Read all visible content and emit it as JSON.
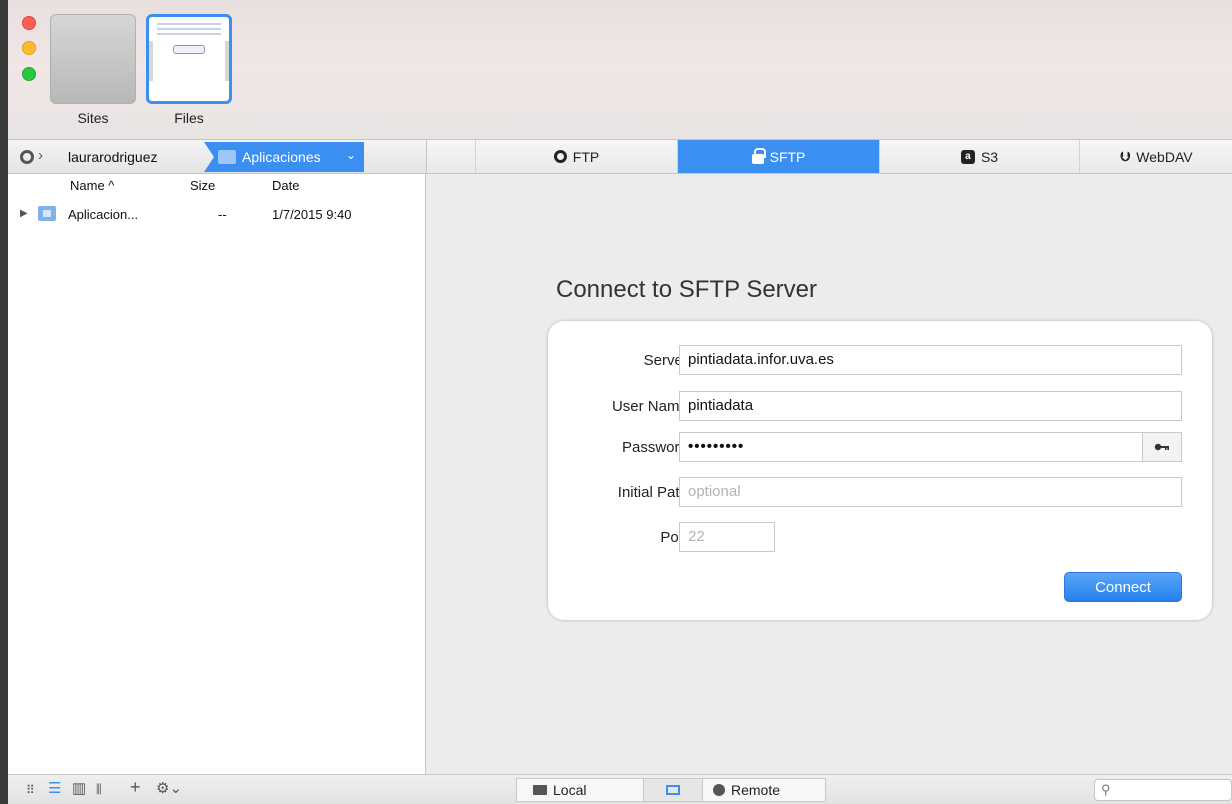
{
  "window": {
    "traffic_lights": [
      "close",
      "minimize",
      "zoom"
    ],
    "colors": {
      "accent": "#3b8ff1",
      "close": "#fc5f57",
      "minimize": "#fdbc2e",
      "zoom": "#29c840"
    }
  },
  "toolbar": {
    "modes": [
      {
        "label": "Sites",
        "selected": false
      },
      {
        "label": "Files",
        "selected": true
      }
    ]
  },
  "breadcrumb": {
    "user": "laurarodriguez",
    "current_folder": "Aplicaciones"
  },
  "protocol_tabs": [
    {
      "label": "FTP",
      "icon": "ftp-ring-icon",
      "active": false
    },
    {
      "label": "SFTP",
      "icon": "lock-icon",
      "active": true
    },
    {
      "label": "S3",
      "icon": "s3-icon",
      "active": false
    },
    {
      "label": "WebDAV",
      "icon": "webdav-icon",
      "active": false
    }
  ],
  "filelist": {
    "columns": {
      "name": "Name ^",
      "size": "Size",
      "date": "Date"
    },
    "rows": [
      {
        "name": "Aplicacion...",
        "size": "--",
        "date": "1/7/2015 9:40"
      }
    ]
  },
  "connect_form": {
    "title": "Connect to SFTP Server",
    "fields": {
      "server": {
        "label": "Server:",
        "value": "pintiadata.infor.uva.es"
      },
      "username": {
        "label": "User Name:",
        "value": "pintiadata"
      },
      "password": {
        "label": "Password:",
        "value": "•••••••••"
      },
      "initial_path": {
        "label": "Initial Path:",
        "value": "",
        "placeholder": "optional"
      },
      "port": {
        "label": "Port:",
        "value": "",
        "placeholder": "22"
      }
    },
    "connect_label": "Connect"
  },
  "bottombar": {
    "add_label": "+",
    "local_label": "Local",
    "remote_label": "Remote"
  }
}
